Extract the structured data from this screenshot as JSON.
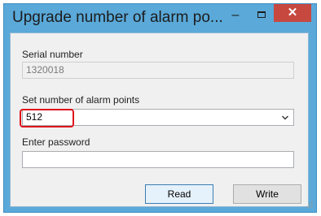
{
  "window": {
    "title": "Upgrade number of alarm po...",
    "minimize_glyph": "–",
    "close_glyph": "✕"
  },
  "serial": {
    "label": "Serial number",
    "value": "1320018"
  },
  "alarm_points": {
    "label": "Set number of alarm points",
    "value": "512"
  },
  "password": {
    "label": "Enter password",
    "value": ""
  },
  "buttons": {
    "read_label": "Read",
    "write_label": "Write"
  },
  "colors": {
    "title_bar": "#5aa9d9",
    "close_button": "#c7483f",
    "highlight": "#e0141b"
  }
}
